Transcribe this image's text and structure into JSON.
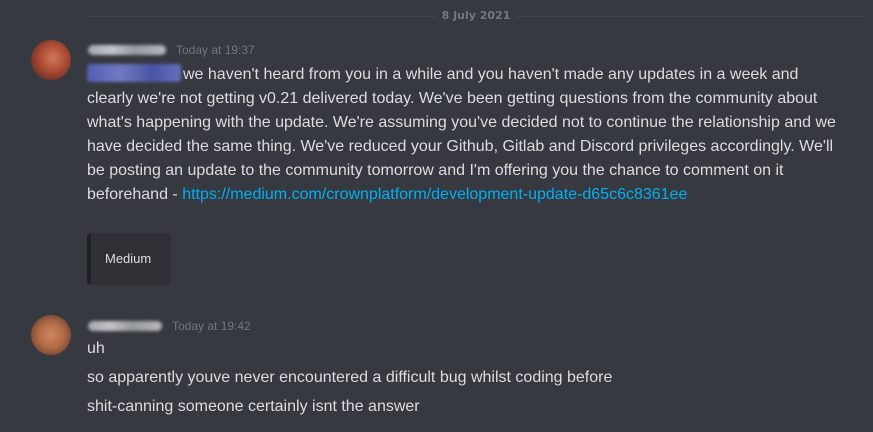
{
  "date_divider": "8 July 2021",
  "messages": [
    {
      "timestamp": "Today at 19:37",
      "text": "we haven't heard from you in a while and you haven't made any updates in a week and clearly we're not getting v0.21 delivered today. We've been getting questions from the community about what's happening with the update. We're assuming you've decided not to continue the relationship and we have decided the same thing. We've reduced your Github, Gitlab and Discord privileges accordingly. We'll be posting an update to the community tomorrow and I'm offering you the chance to comment on it beforehand - ",
      "link": "https://medium.com/crownplatform/development-update-d65c6c8361ee",
      "embed_provider": "Medium"
    },
    {
      "timestamp": "Today at 19:42",
      "lines": [
        "uh",
        "so apparently youve never encountered a difficult bug whilst coding before",
        "shit-canning someone certainly isnt the answer"
      ]
    }
  ],
  "colors": {
    "background": "#36393f",
    "text": "#dcddde",
    "muted": "#72767d",
    "link": "#00b0f4",
    "embed_bg": "#2f3136"
  }
}
